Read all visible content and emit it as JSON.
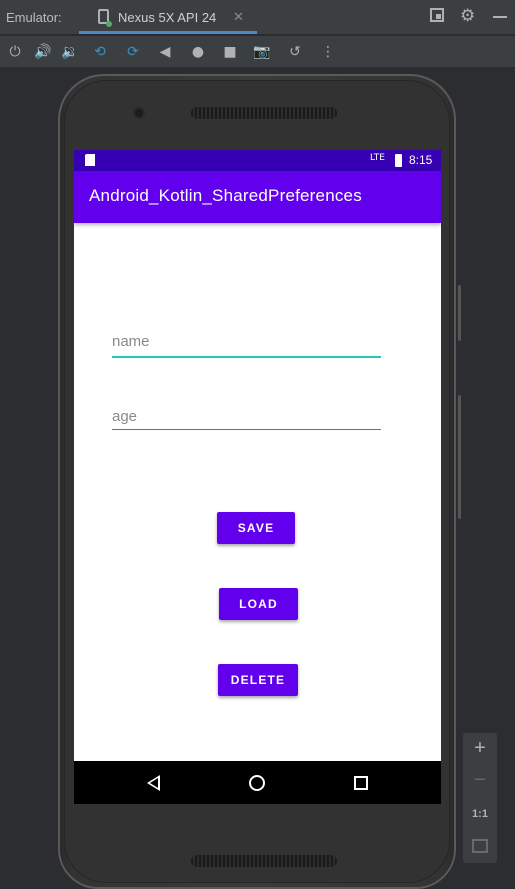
{
  "tool_window": {
    "label": "Emulator:",
    "tab_title": "Nexus 5X API 24",
    "tab_close": "✕"
  },
  "header_icons": [
    "restore-layout-icon",
    "gear-icon",
    "minimize-icon"
  ],
  "toolbar_icons": [
    "power-icon",
    "volume-up-icon",
    "volume-down-icon",
    "rotate-left-icon",
    "rotate-right-icon",
    "back-icon",
    "home-icon",
    "overview-icon",
    "screenshot-icon",
    "snapshot-icon",
    "more-icon"
  ],
  "device": {
    "status_bar": {
      "network": "LTE",
      "time": "8:15"
    },
    "app_title": "Android_Kotlin_SharedPreferences",
    "fields": {
      "name_placeholder": "name",
      "age_placeholder": "age"
    },
    "buttons": {
      "save": "SAVE",
      "load": "LOAD",
      "delete": "DELETE"
    }
  },
  "zoom_panel": {
    "zoom_in": "+",
    "zoom_out": "−",
    "actual_size": "1:1"
  },
  "colors": {
    "primary": "#6200ee",
    "primary_dark": "#3700b3",
    "accent": "#26c6b8",
    "ide_background": "#2b2d30",
    "ide_panel": "#3c3f41"
  }
}
